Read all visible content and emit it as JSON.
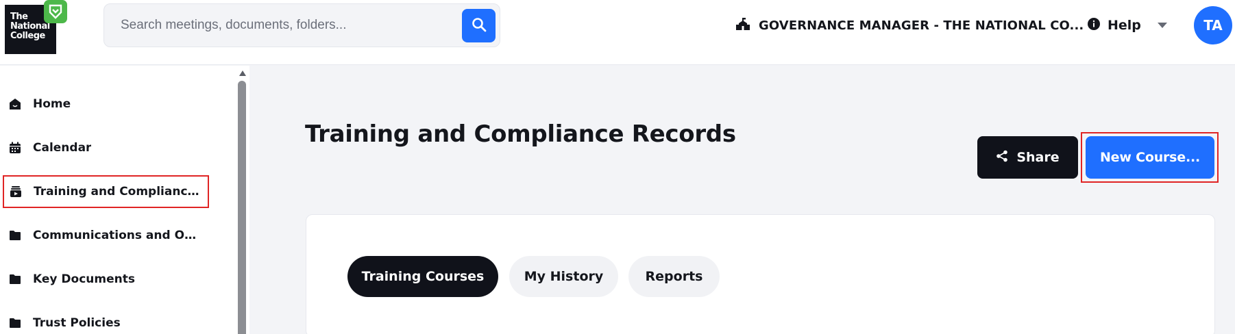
{
  "header": {
    "logo_lines": [
      "The",
      "National",
      "College"
    ],
    "search": {
      "placeholder": "Search meetings, documents, folders..."
    },
    "organisation": "GOVERNANCE MANAGER - THE NATIONAL CO...",
    "help_label": "Help",
    "avatar_initials": "TA"
  },
  "sidebar": {
    "items": [
      {
        "label": "Home",
        "icon": "home-icon"
      },
      {
        "label": "Calendar",
        "icon": "calendar-icon"
      },
      {
        "label": "Training and Compliance...",
        "icon": "training-icon"
      },
      {
        "label": "Communications and Op...",
        "icon": "folder-icon"
      },
      {
        "label": "Key Documents",
        "icon": "folder-icon"
      },
      {
        "label": "Trust Policies",
        "icon": "folder-icon"
      }
    ]
  },
  "main": {
    "title": "Training and Compliance Records",
    "share_label": "Share",
    "new_course_label": "New Course...",
    "tabs": [
      {
        "label": "Training Courses",
        "active": true
      },
      {
        "label": "My History",
        "active": false
      },
      {
        "label": "Reports",
        "active": false
      }
    ]
  },
  "colors": {
    "accent": "#1f6fff",
    "dark": "#10121a",
    "highlight": "#e02424",
    "logo_badge": "#4db84a"
  }
}
